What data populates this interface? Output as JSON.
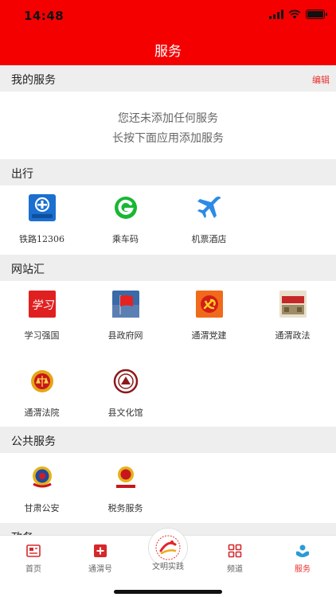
{
  "status_bar": {
    "time": "14:48"
  },
  "header": {
    "title": "服务"
  },
  "my_services": {
    "title": "我的服务",
    "edit_label": "编辑",
    "empty_line1": "您还未添加任何服务",
    "empty_line2": "长按下面应用添加服务"
  },
  "travel": {
    "title": "出行",
    "items": [
      {
        "label": "铁路12306",
        "icon": "railway-12306-icon"
      },
      {
        "label": "乘车码",
        "icon": "ride-code-icon"
      },
      {
        "label": "机票酒店",
        "icon": "airplane-icon"
      }
    ]
  },
  "websites": {
    "title": "网站汇",
    "items": [
      {
        "label": "学习强国",
        "icon": "xuexi-qiangguo-icon",
        "logo_text": "学习"
      },
      {
        "label": "县政府网",
        "icon": "county-gov-flag-icon"
      },
      {
        "label": "通渭党建",
        "icon": "party-building-icon"
      },
      {
        "label": "通渭政法",
        "icon": "politics-law-icon"
      },
      {
        "label": "通渭法院",
        "icon": "court-emblem-icon"
      },
      {
        "label": "县文化馆",
        "icon": "culture-hall-icon"
      }
    ]
  },
  "public_services": {
    "title": "公共服务",
    "items": [
      {
        "label": "甘肃公安",
        "icon": "police-emblem-icon"
      },
      {
        "label": "税务服务",
        "icon": "tax-emblem-icon"
      }
    ]
  },
  "partial_section": {
    "title": "政务"
  },
  "tabbar": {
    "active_color": "#e8322e",
    "items": [
      {
        "label": "首页",
        "icon": "home-news-icon"
      },
      {
        "label": "通渭号",
        "icon": "plus-box-icon"
      },
      {
        "label": "文明实践",
        "icon": "civilization-practice-logo"
      },
      {
        "label": "频道",
        "icon": "grid-icon"
      },
      {
        "label": "服务",
        "icon": "service-hands-icon"
      }
    ]
  },
  "colors": {
    "brand_red": "#f40000",
    "section_bg": "#eeeeee"
  }
}
